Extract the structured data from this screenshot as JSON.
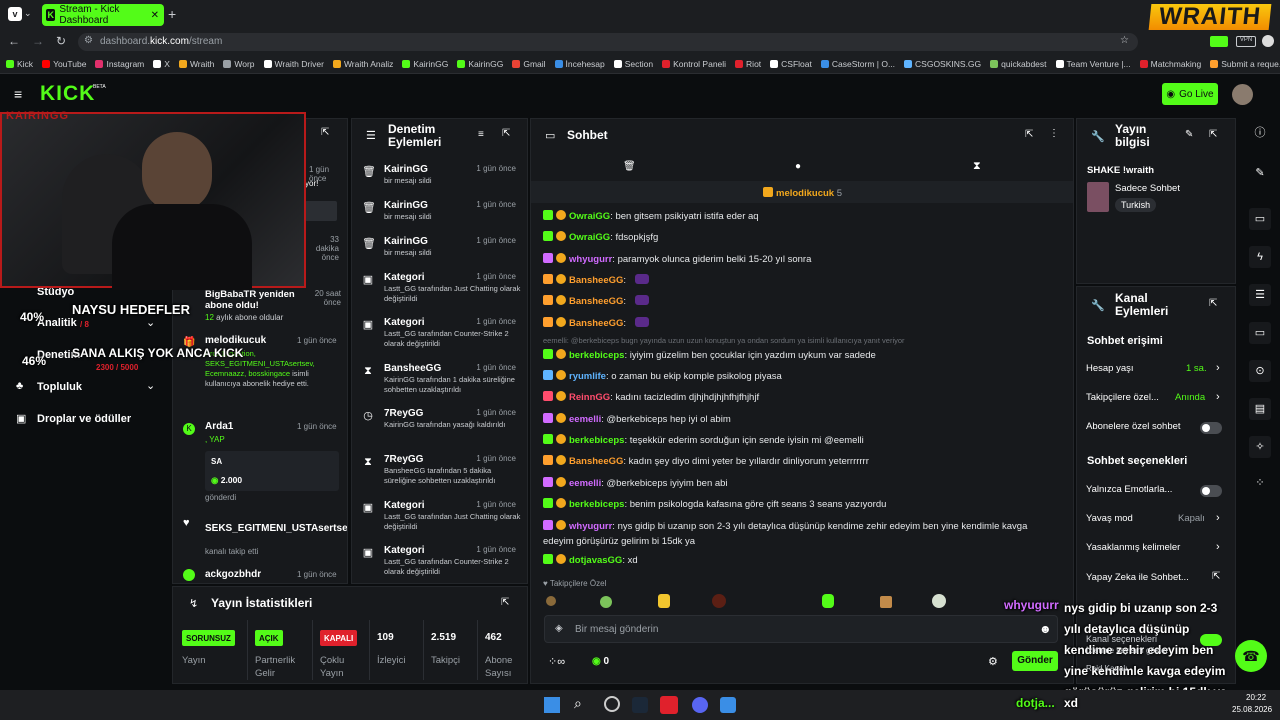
{
  "browser": {
    "tab_title": "Stream - Kick Dashboard",
    "url_prefix": "dashboard.",
    "url_domain": "kick.com",
    "url_path": "/stream",
    "bookmarks": [
      "Kick",
      "YouTube",
      "Instagram",
      "X",
      "Wraith",
      "Worp",
      "Wraith Driver",
      "Wraith Analiz",
      "KairinGG",
      "KairinGG",
      "Gmail",
      "İncehesap",
      "Section",
      "Kontrol Paneli",
      "Riot",
      "CSFloat",
      "CaseStorm | O...",
      "CSGOSKINS.GG",
      "quickabdest",
      "Team Venture |...",
      "Matchmaking",
      "Submit a reque..."
    ]
  },
  "header": {
    "logo": "KICK",
    "beta": "BETA",
    "go_live": "Go Live"
  },
  "overlay": {
    "wraith": "WRAITH",
    "channel": "KAIRINGG",
    "naysu_title": "NAYSU HEDEFLER",
    "goal1_pct": "40%",
    "goal2_pct": "46%",
    "goal2_text": "SANA ALKIŞ YOK ANCA KICK",
    "goal2_sub": "2300 / 5000",
    "goal1_sub": "/ 8"
  },
  "sidebar": {
    "items": [
      "Stüdyo",
      "Analitik",
      "Denetim",
      "Topluluk",
      "Droplar ve ödüller"
    ]
  },
  "activity": {
    "frag1": {
      "t": "1 gün önce",
      "d": "yor!"
    },
    "e1": {
      "t": "33 dakika önce"
    },
    "e2": {
      "name": "BigBabaTR yeniden abone oldu!",
      "t": "20 saat önce",
      "d1": "12",
      "d2": " aylık abone oldular"
    },
    "e3": {
      "name": "melodikucuk",
      "t": "1 gün önce",
      "d1": "Arda1, qaution, SEKS_EGITMENI_USTAsertsev, Ecemnaazz, bosskingace",
      "d2": " isimli kullanıcıya abonelik hediye etti."
    },
    "e4": {
      "name": "Arda1",
      "t": "1 gün önce",
      "sub": ", YAP",
      "msg": "SA",
      "amount": "2.000",
      "d": "gönderdi"
    },
    "e5": {
      "name": "SEKS_EGITMENI_USTAsertsev",
      "d": "kanalı takip etti"
    },
    "e6": {
      "name": "ackgozbhdr",
      "t": "1 gün önce"
    }
  },
  "mod": {
    "title": "Denetim Eylemleri",
    "rows": [
      {
        "icon": "trash-icon",
        "name": "KairinGG",
        "time": "1 gün önce",
        "desc": "bir mesajı sildi"
      },
      {
        "icon": "trash-icon",
        "name": "KairinGG",
        "time": "1 gün önce",
        "desc": "bir mesajı sildi"
      },
      {
        "icon": "trash-icon",
        "name": "KairinGG",
        "time": "1 gün önce",
        "desc": "bir mesajı sildi"
      },
      {
        "icon": "category-icon",
        "name": "Kategori",
        "time": "1 gün önce",
        "desc": "Lastt_GG tarafından Just Chatting olarak değiştirildi"
      },
      {
        "icon": "category-icon",
        "name": "Kategori",
        "time": "1 gün önce",
        "desc": "Lastt_GG tarafından Counter-Strike 2 olarak değiştirildi"
      },
      {
        "icon": "hourglass-icon",
        "name": "BansheeGG",
        "time": "1 gün önce",
        "desc": "KairinGG tarafından 1 dakika süreliğine sohbetten uzaklaştırıldı"
      },
      {
        "icon": "clock-icon",
        "name": "7ReyGG",
        "time": "1 gün önce",
        "desc": "KairinGG tarafından yasağı kaldırıldı"
      },
      {
        "icon": "hourglass-icon",
        "name": "7ReyGG",
        "time": "1 gün önce",
        "desc": "BansheeGG tarafından 5 dakika süreliğine sohbetten uzaklaştırıldı"
      },
      {
        "icon": "category-icon",
        "name": "Kategori",
        "time": "1 gün önce",
        "desc": "Lastt_GG tarafından Just Chatting olarak değiştirildi"
      },
      {
        "icon": "category-icon",
        "name": "Kategori",
        "time": "1 gün önce",
        "desc": "Lastt_GG tarafından Counter-Strike 2 olarak değiştirildi"
      }
    ]
  },
  "chat": {
    "title": "Sohbet",
    "pinned_user": "melodikucuk",
    "pinned_count": "5",
    "input_placeholder": "Bir mesaj gönderin",
    "send": "Gönder",
    "points": "0",
    "followers_only": "Takipçilere Özel",
    "reply_hint": "eemelli: @berkebiceps bugn yayında uzun uzun konuştun ya ondan sordum ya isimli kullanıcıya yanıt veriyor",
    "messages": [
      {
        "user": "OwraiGG",
        "color": "#53fc18",
        "text": "ben gitsem psikiyatri istifa eder aq"
      },
      {
        "user": "OwraiGG",
        "color": "#53fc18",
        "text": "fdsopkjşfg"
      },
      {
        "user": "whyugurr",
        "color": "#d16bff",
        "text": "paramyok olunca giderim belki 15-20 yıl sonra"
      },
      {
        "user": "BansheeGG",
        "color": "#ff9f2e",
        "text": ""
      },
      {
        "user": "BansheeGG",
        "color": "#ff9f2e",
        "text": ""
      },
      {
        "user": "BansheeGG",
        "color": "#ff9f2e",
        "text": ""
      },
      {
        "user": "berkebiceps",
        "color": "#53fc18",
        "text": "iyiyim güzelim ben çocuklar için yazdım uykum var sadede"
      },
      {
        "user": "ryumlife",
        "color": "#5fb4ff",
        "text": "o zaman bu ekip komple psikolog piyasa"
      },
      {
        "user": "ReinnGG",
        "color": "#ff4d6d",
        "text": "kadını tacizledim djhjhdjhjhfhjfhjhjf"
      },
      {
        "user": "eemelli",
        "color": "#d16bff",
        "text": "@berkebiceps hep iyi ol abim"
      },
      {
        "user": "berkebiceps",
        "color": "#53fc18",
        "text": "teşekkür ederim sorduğun için sende iyisin mi @eemelli"
      },
      {
        "user": "BansheeGG",
        "color": "#ff9f2e",
        "text": "kadın şey diyo dimi yeter be yıllardır dinliyorum yeterrrrrrr"
      },
      {
        "user": "eemelli",
        "color": "#d16bff",
        "text": "@berkebiceps iyiyim ben abi"
      },
      {
        "user": "berkebiceps",
        "color": "#53fc18",
        "text": "benim psikologda kafasına göre çift seans 3 seans yazıyordu"
      },
      {
        "user": "whyugurr",
        "color": "#d16bff",
        "text": "nys gidip bi uzanıp son 2-3 yılı detaylıca düşünüp kendime zehir edeyim ben yine kendimle kavga edeyim görüşürüz gelirim bi 15dk ya"
      },
      {
        "user": "dotjavasGG",
        "color": "#53fc18",
        "text": "xd"
      }
    ]
  },
  "info": {
    "title": "Yayın bilgisi",
    "stream_title": "SHAKE !wraith",
    "category": "Sadece Sohbet",
    "language": "Turkish"
  },
  "channel": {
    "title": "Kanal Eylemleri",
    "chat_access": "Sohbet erişimi",
    "rows": [
      {
        "label": "Hesap yaşı",
        "value": "1 sa."
      },
      {
        "label": "Takipçilere özel...",
        "value": "Anında"
      },
      {
        "label": "Abonelere özel sohbet",
        "value": ""
      }
    ],
    "chat_options": "Sohbet seçenekleri",
    "rows2": [
      {
        "label": "Yalnızca Emotlarla...",
        "value": ""
      },
      {
        "label": "Yavaş mod",
        "value": "Kapalı"
      },
      {
        "label": "Yasaklanmış kelimeler",
        "value": ""
      },
      {
        "label": "Yapay Zeka ile Sohbet...",
        "value": ""
      }
    ],
    "partial1": "Kanal seçenekleri",
    "partial2": "İzlenme sayısını göster",
    "partial3": "Raid Kanalı"
  },
  "stats": {
    "title": "Yayın İstatistikleri",
    "cols": [
      {
        "badge": "SORUNSUZ",
        "label": "Yayın",
        "color": "#53fc18"
      },
      {
        "badge": "AÇIK",
        "label": "Partnerlik Gelir",
        "color": "#53fc18"
      },
      {
        "badge": "KAPALI",
        "label": "Çoklu Yayın",
        "color": "#e0212c"
      },
      {
        "value": "109",
        "label": "İzleyici"
      },
      {
        "value": "2.519",
        "label": "Takipçi"
      },
      {
        "value": "462",
        "label": "Abone Sayısı"
      }
    ]
  },
  "caption": {
    "user": "whyugurr",
    "text": "nys gidip bi uzanıp son 2-3 yılı detaylıca düşünüp kendime zehir edeyim ben yine kendimle kavga edeyim görüşürüz gelirim bi 15dk ya",
    "user2": "dotja...",
    "text2": "xd"
  },
  "taskbar": {
    "time": "20:22",
    "date": "25.08.2026"
  },
  "colors": {
    "accent": "#53fc18",
    "danger": "#e0212c",
    "panel": "#17191c",
    "bg": "#0b0d0f"
  }
}
